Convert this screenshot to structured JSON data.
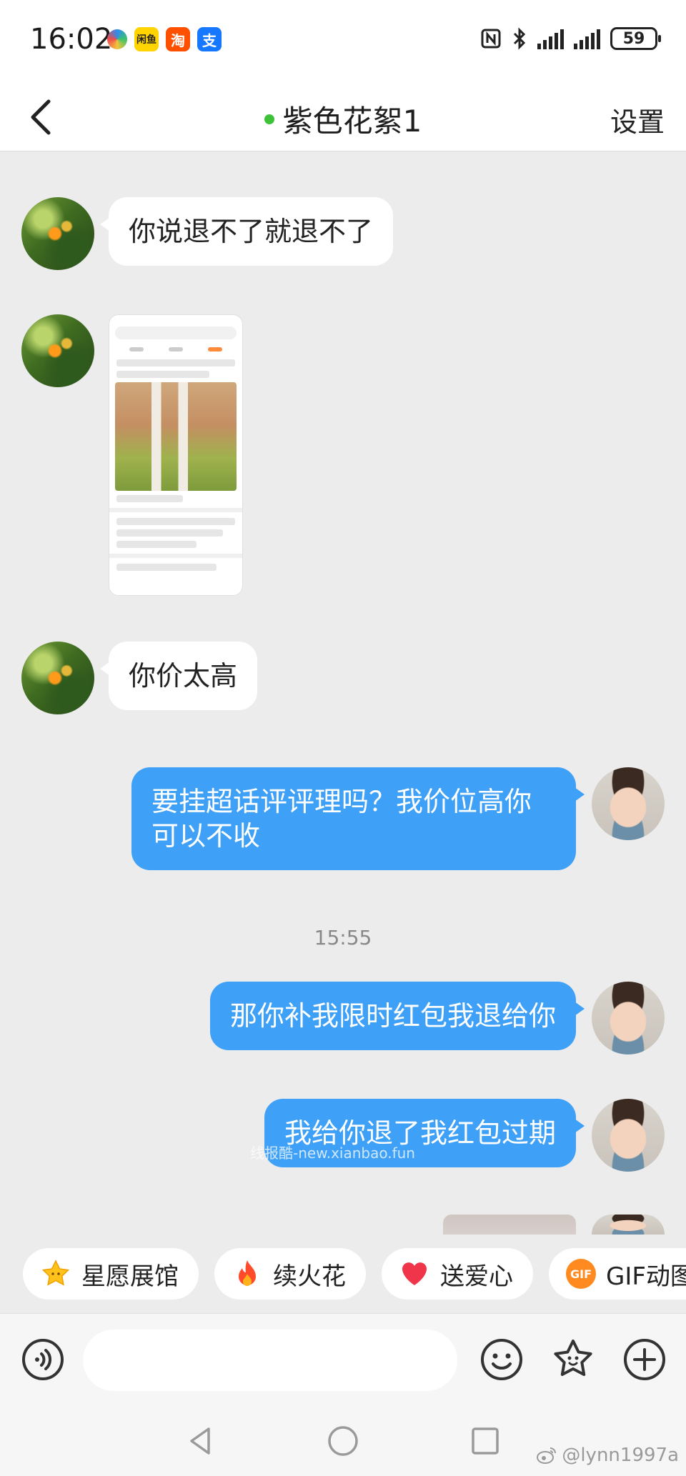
{
  "status_bar": {
    "time": "16:02",
    "app_icons": [
      {
        "icon": "colorful-circle-icon",
        "label": ""
      },
      {
        "icon": "xianyu-app-icon",
        "label": "闲鱼"
      },
      {
        "icon": "taobao-app-icon",
        "label": "淘"
      },
      {
        "icon": "alipay-app-icon",
        "label": "支"
      }
    ],
    "battery": "59"
  },
  "header": {
    "title": "紫色花絮1",
    "settings_label": "设置",
    "online_color": "#3fc23a"
  },
  "messages": [
    {
      "side": "in",
      "type": "text",
      "text": "你说退不了就退不了"
    },
    {
      "side": "in",
      "type": "image",
      "text": ""
    },
    {
      "side": "in",
      "type": "text",
      "text": "你价太高"
    },
    {
      "side": "out",
      "type": "text",
      "text": "要挂超话评评理吗？我价位高你可以不收"
    },
    {
      "side": "out",
      "type": "text",
      "text": "那你补我限时红包我退给你"
    },
    {
      "side": "out",
      "type": "text",
      "text": "我给你退了我红包过期"
    }
  ],
  "timestamp": "15:55",
  "overlay_watermark": "线报酷-new.xianbao.fun",
  "quick_actions": [
    {
      "icon": "star-icon",
      "label": "星愿展馆"
    },
    {
      "icon": "fire-icon",
      "label": "续火花"
    },
    {
      "icon": "heart-icon",
      "label": "送爱心"
    },
    {
      "icon": "gif-icon",
      "label": "GIF动图",
      "badge": "GIF"
    }
  ],
  "input": {
    "value": "",
    "placeholder": ""
  },
  "footer_watermark": "@lynn1997a",
  "colors": {
    "outgoing_bubble": "#3ea0f7",
    "incoming_bubble": "#ffffff",
    "background": "#ececec"
  }
}
